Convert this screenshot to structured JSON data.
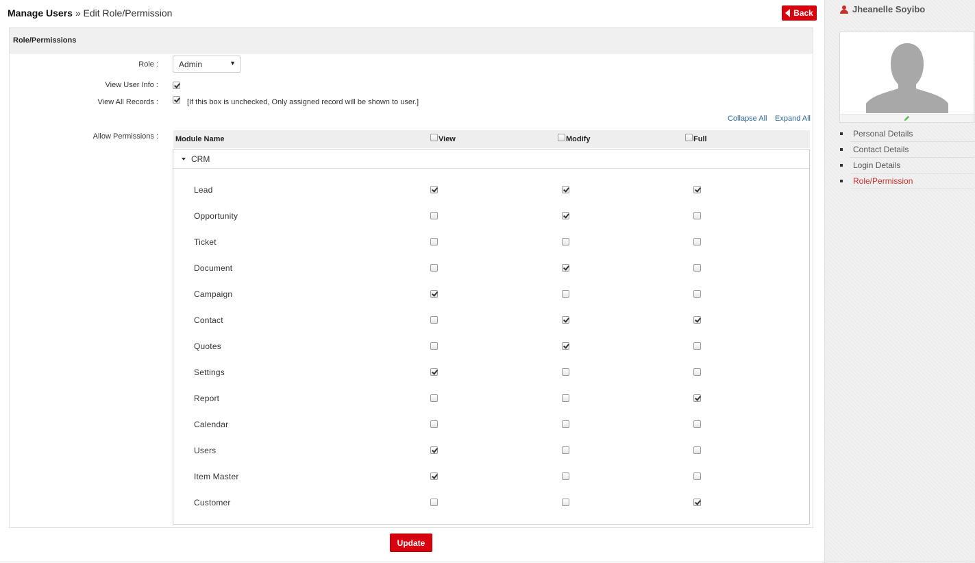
{
  "breadcrumb": {
    "root": "Manage Users",
    "separator": " » ",
    "current": "Edit Role/Permission"
  },
  "back_label": "Back",
  "panel_title": "Role/Permissions",
  "role": {
    "label": "Role :",
    "value": "Admin"
  },
  "view_user_info": {
    "label": "View User Info :",
    "checked": true
  },
  "view_all_records": {
    "label": "View All Records :",
    "checked": true,
    "note": "[If this box is unchecked, Only assigned record will be shown to user.]"
  },
  "links": {
    "collapse": "Collapse All",
    "expand": "Expand All"
  },
  "permissions_label": "Allow Permissions :",
  "table_headers": {
    "module": "Module Name",
    "view": "View",
    "modify": "Modify",
    "full": "Full"
  },
  "group": {
    "name": "CRM"
  },
  "modules": [
    {
      "name": "Lead",
      "view": true,
      "modify": true,
      "full": true
    },
    {
      "name": "Opportunity",
      "view": false,
      "modify": true,
      "full": false
    },
    {
      "name": "Ticket",
      "view": false,
      "modify": false,
      "full": false
    },
    {
      "name": "Document",
      "view": false,
      "modify": true,
      "full": false
    },
    {
      "name": "Campaign",
      "view": true,
      "modify": false,
      "full": false
    },
    {
      "name": "Contact",
      "view": false,
      "modify": true,
      "full": true
    },
    {
      "name": "Quotes",
      "view": false,
      "modify": true,
      "full": false
    },
    {
      "name": "Settings",
      "view": true,
      "modify": false,
      "full": false
    },
    {
      "name": "Report",
      "view": false,
      "modify": false,
      "full": true
    },
    {
      "name": "Calendar",
      "view": false,
      "modify": false,
      "full": false
    },
    {
      "name": "Users",
      "view": true,
      "modify": false,
      "full": false
    },
    {
      "name": "Item Master",
      "view": true,
      "modify": false,
      "full": false
    },
    {
      "name": "Customer",
      "view": false,
      "modify": false,
      "full": true
    }
  ],
  "update_label": "Update",
  "sidebar": {
    "user_name": "Jheanelle Soyibo",
    "items": [
      {
        "label": "Personal Details",
        "active": false
      },
      {
        "label": "Contact Details",
        "active": false
      },
      {
        "label": "Login Details",
        "active": false
      },
      {
        "label": "Role/Permission",
        "active": true
      }
    ]
  },
  "colors": {
    "accent_red": "#d6000e",
    "link_blue": "#2a6496",
    "active_red": "#c9302c"
  }
}
